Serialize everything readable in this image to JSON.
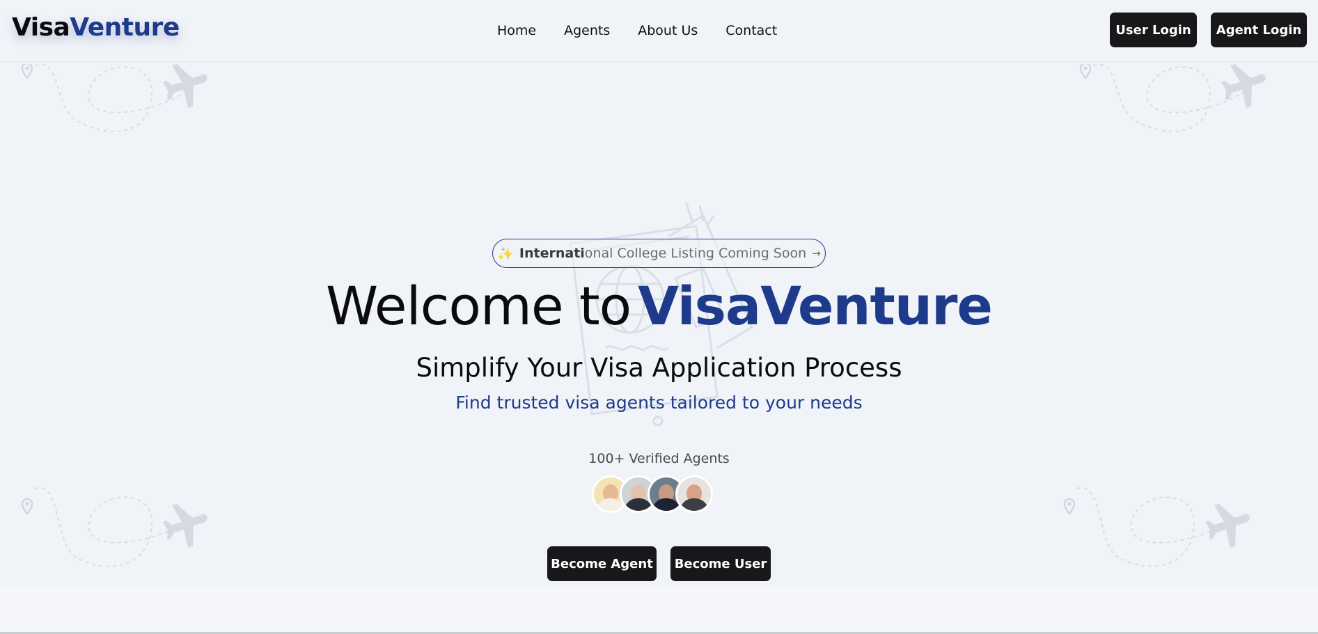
{
  "brand": {
    "part1": "Visa",
    "part2": "Venture"
  },
  "nav": {
    "items": [
      "Home",
      "Agents",
      "About Us",
      "Contact"
    ]
  },
  "header_buttons": {
    "user_login": "User Login",
    "agent_login": "Agent Login"
  },
  "announcement": {
    "icon": "sparkles-icon",
    "emoji": "✨",
    "text_strong": "Internati",
    "text_rest": "onal College Listing Coming Soon",
    "arrow": "→"
  },
  "hero": {
    "title_part1": "Welcome to",
    "title_part2": "VisaVenture",
    "subtitle": "Simplify Your Visa Application Process",
    "tagline": "Find trusted visa agents tailored to your needs",
    "verified_agents": "100+ Verified Agents"
  },
  "cta": {
    "become_agent": "Become Agent",
    "become_user": "Become User"
  },
  "colors": {
    "background": "#f0f3f8",
    "accent": "#1e3a8a",
    "button_dark": "#18181b",
    "text": "#0b0b0f"
  }
}
